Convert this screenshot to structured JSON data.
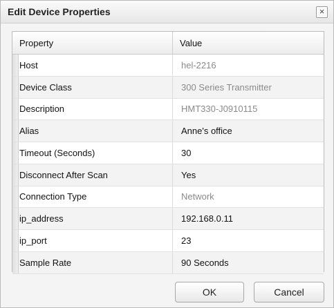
{
  "dialog": {
    "title": "Edit Device Properties",
    "close_glyph": "×"
  },
  "grid": {
    "columns": [
      "Property",
      "Value"
    ],
    "rows": [
      {
        "property": "Host",
        "value": "hel-2216",
        "editable": false
      },
      {
        "property": "Device Class",
        "value": "300 Series Transmitter",
        "editable": false
      },
      {
        "property": "Description",
        "value": "HMT330-J0910115",
        "editable": false
      },
      {
        "property": "Alias",
        "value": "Anne's office",
        "editable": true
      },
      {
        "property": "Timeout (Seconds)",
        "value": "30",
        "editable": true
      },
      {
        "property": "Disconnect After Scan",
        "value": "Yes",
        "editable": true
      },
      {
        "property": "Connection Type",
        "value": "Network",
        "editable": false
      },
      {
        "property": "ip_address",
        "value": "192.168.0.11",
        "editable": true
      },
      {
        "property": "ip_port",
        "value": "23",
        "editable": true
      },
      {
        "property": "Sample Rate",
        "value": "90 Seconds",
        "editable": true
      }
    ]
  },
  "buttons": {
    "ok_label": "OK",
    "cancel_label": "Cancel"
  }
}
